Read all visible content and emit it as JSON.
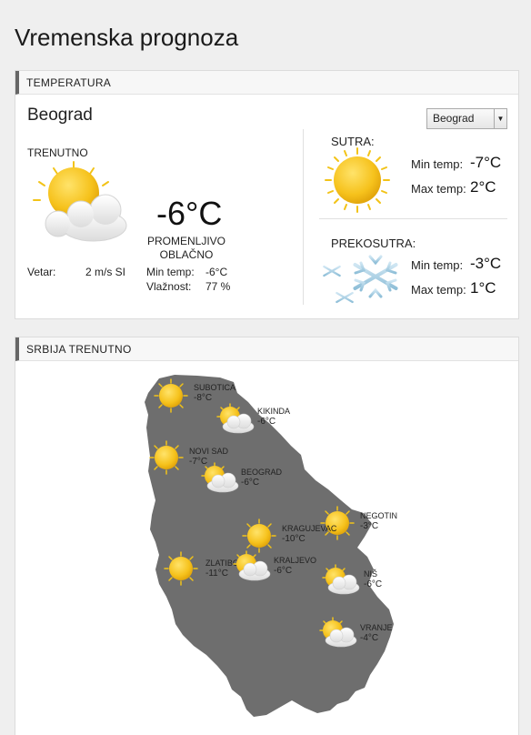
{
  "page": {
    "title": "Vremenska prognoza"
  },
  "temperatura": {
    "header": "TEMPERATURA",
    "city": "Beograd",
    "select_value": "Beograd",
    "current": {
      "label": "TRENUTNO",
      "icon": "sun-cloud-icon",
      "temp": "-6°C",
      "desc_line1": "PROMENLJIVO",
      "desc_line2": "OBLAČNO",
      "wind_label": "Vetar:",
      "wind_value": "2 m/s SI",
      "min_label": "Min temp:",
      "min_value": "-6°C",
      "humidity_label": "Vlažnost:",
      "humidity_value": "77 %"
    },
    "tomorrow": {
      "label": "SUTRA:",
      "icon": "sun-icon",
      "min_label": "Min temp:",
      "min_value": "-7°C",
      "max_label": "Max temp:",
      "max_value": "2°C"
    },
    "day_after": {
      "label": "PREKOSUTRA:",
      "icon": "snowflake-icon",
      "min_label": "Min temp:",
      "min_value": "-3°C",
      "max_label": "Max temp:",
      "max_value": "1°C"
    }
  },
  "srbija": {
    "header": "SRBIJA TRENUTNO",
    "cities": [
      {
        "name": "SUBOTICA",
        "temp": "-8°C",
        "icon": "sun-icon"
      },
      {
        "name": "KIKINDA",
        "temp": "-6°C",
        "icon": "sun-cloud-icon"
      },
      {
        "name": "NOVI SAD",
        "temp": "-7°C",
        "icon": "sun-icon"
      },
      {
        "name": "BEOGRAD",
        "temp": "-6°C",
        "icon": "sun-cloud-icon"
      },
      {
        "name": "NEGOTIN",
        "temp": "-3°C",
        "icon": "sun-icon"
      },
      {
        "name": "KRAGUJEVAC",
        "temp": "-10°C",
        "icon": "sun-icon"
      },
      {
        "name": "ZLATIBOR",
        "temp": "-11°C",
        "icon": "sun-icon"
      },
      {
        "name": "KRALJEVO",
        "temp": "-6°C",
        "icon": "sun-cloud-icon"
      },
      {
        "name": "NIŠ",
        "temp": "-6°C",
        "icon": "sun-cloud-icon"
      },
      {
        "name": "VRANJE",
        "temp": "-4°C",
        "icon": "sun-cloud-icon"
      }
    ]
  }
}
